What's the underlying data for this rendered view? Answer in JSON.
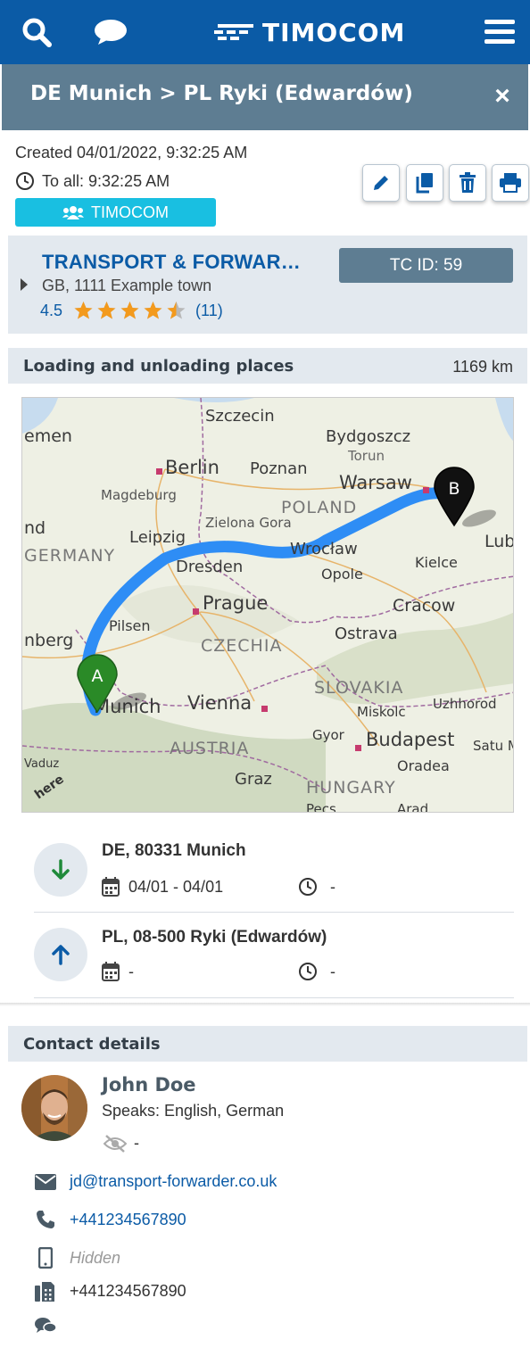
{
  "header": {
    "brand": "TIMOCOM",
    "search_icon": "search-icon",
    "chat_icon": "chat-icon",
    "menu_icon": "hamburger-menu-icon",
    "color": "#0b5ba6"
  },
  "title": {
    "text": "DE Munich > PL Ryki (Edwardów)",
    "close": "×"
  },
  "offer": {
    "created": "Created 04/01/2022, 9:32:25 AM",
    "to_all": "To all: 9:32:25 AM",
    "badge": "TIMOCOM",
    "actions": [
      "edit",
      "copy",
      "delete",
      "print"
    ]
  },
  "company": {
    "name": "TRANSPORT & FORWAR…",
    "address": "GB, 1111 Example town",
    "rating_value": "4.5",
    "rating_stars": 4.5,
    "rating_count": "(11)",
    "tc_id": "TC ID: 59"
  },
  "route": {
    "heading": "Loading and unloading places",
    "distance": "1169 km",
    "map": {
      "cities": [
        "Szczecin",
        "Bydgoszcz",
        "Torun",
        "Berlin",
        "Poznan",
        "Warsaw",
        "Magdeburg",
        "POLAND",
        "Zielona Gora",
        "Leipzig",
        "Lub",
        "Dresden",
        "Wrocław",
        "Opole",
        "Kielce",
        "Prague",
        "Cracow",
        "Pilsen",
        "CZECHIA",
        "Ostrava",
        "SLOVAKIA",
        "Uzhhorod",
        "Munich",
        "Vienna",
        "Miskolc",
        "Gyor",
        "Budapest",
        "Satu Mare",
        "AUSTRIA",
        "Oradea",
        "Graz",
        "HUNGARY",
        "Pecs",
        "Arad",
        "Vaduz",
        "GERMANY",
        "emen",
        "nd",
        "nberg"
      ],
      "marker_a": "A",
      "marker_b": "B",
      "attribution": "here"
    },
    "stops": [
      {
        "place": "DE, 80331 Munich",
        "date": "04/01 - 04/01",
        "time": "-",
        "direction": "loading"
      },
      {
        "place": "PL, 08-500 Ryki (Edwardów)",
        "date": "-",
        "time": "-",
        "direction": "unloading"
      }
    ]
  },
  "contact": {
    "heading": "Contact details",
    "name": "John Doe",
    "speaks": "Speaks: English, German",
    "visibility": "-",
    "email": "jd@transport-forwarder.co.uk",
    "phone": "+441234567890",
    "mobile": "Hidden",
    "fax": "+441234567890",
    "messenger": ""
  }
}
